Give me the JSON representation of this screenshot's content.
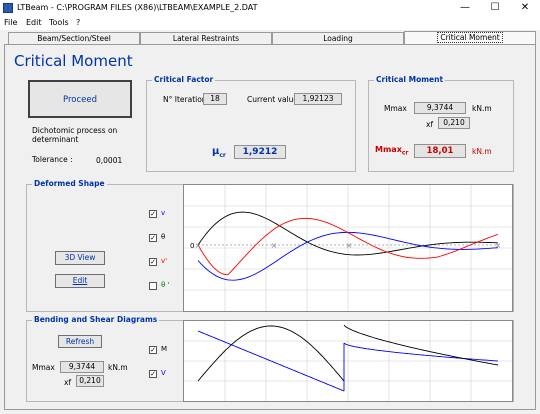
{
  "window": {
    "title": "LTBeam - C:\\PROGRAM FILES (X86)\\LTBEAM\\EXAMPLE_2.DAT",
    "minimize": "—",
    "maximize": "☐",
    "close": "✕"
  },
  "menu": [
    "File",
    "Edit",
    "Tools",
    "?"
  ],
  "tabs": [
    "Beam/Section/Steel",
    "Lateral Restraints",
    "Loading",
    "Critical Moment"
  ],
  "active_tab": "Critical Moment",
  "heading": "Critical Moment",
  "proceed": {
    "label": "Proceed"
  },
  "process_note": "Dichotomic process on determinant",
  "tolerance": {
    "label": "Tolerance :",
    "value": "0,0001"
  },
  "critical_factor": {
    "title": "Critical Factor",
    "iteration_label": "N° Iteration",
    "iteration_value": "18",
    "current_label": "Current value",
    "current_value": "1,92123",
    "mu_label": "μ",
    "mu_sub": "cr",
    "mu_value": "1,9212"
  },
  "critical_moment": {
    "title": "Critical Moment",
    "mmax_label": "Mmax",
    "mmax_value": "9,3744",
    "mmax_unit": "kN.m",
    "xf_label": "xf",
    "xf_value": "0,210",
    "mcr_label": "Mmax",
    "mcr_sub": "cr",
    "mcr_value": "18,01",
    "mcr_unit": "kN.m"
  },
  "deformed": {
    "title": "Deformed Shape",
    "view3d": "3D View",
    "edit": "Edit",
    "checks": [
      {
        "label": "v",
        "checked": true,
        "color": "#0000ff"
      },
      {
        "label": "θ",
        "checked": true,
        "color": "#000000"
      },
      {
        "label": "v'",
        "checked": true,
        "color": "#ff0000"
      },
      {
        "label": "θ '",
        "checked": false,
        "color": "#008000"
      }
    ],
    "zero_label": "0"
  },
  "diagrams": {
    "title": "Bending and Shear Diagrams",
    "refresh": "Refresh",
    "mmax_label": "Mmax",
    "mmax_value": "9,3744",
    "mmax_unit": "kN.m",
    "xf_label": "xf",
    "xf_value": "0,210",
    "checks": [
      {
        "label": "M",
        "checked": true,
        "color": "#000000"
      },
      {
        "label": "V",
        "checked": true,
        "color": "#0000ff"
      }
    ]
  },
  "colors": {
    "accent": "#0033aa",
    "red": "#cc0000",
    "blue": "#0000ff"
  }
}
